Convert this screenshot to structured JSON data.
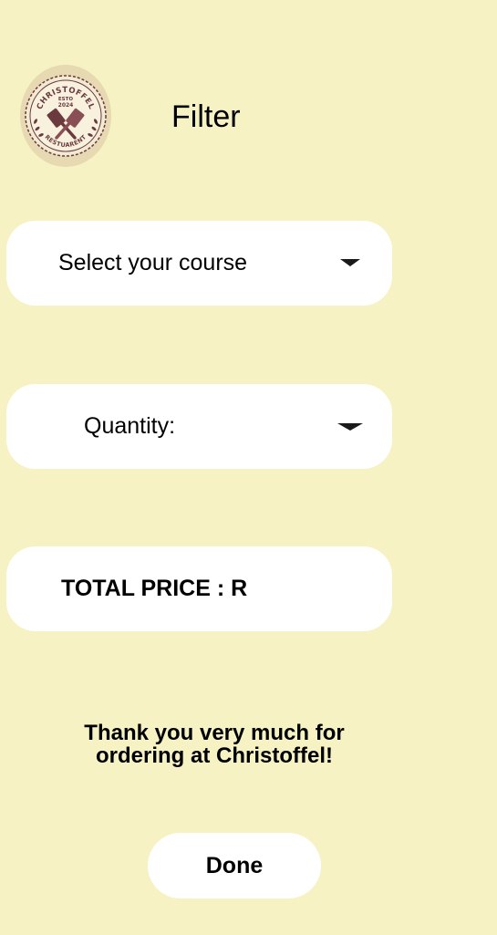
{
  "header": {
    "title": "Filter",
    "logo": {
      "icon": "restaurant-logo-icon",
      "top_text": "CHRISTOFFEL",
      "bottom_text": "RESTUARENT",
      "center_text_1": "ESTO",
      "center_text_2": "2024"
    }
  },
  "course_select": {
    "label": "Select your course",
    "icon": "chevron-down-icon"
  },
  "quantity_select": {
    "label": "Quantity:",
    "icon": "chevron-down-icon"
  },
  "total_price": {
    "label": "TOTAL PRICE :  R"
  },
  "thank_you": {
    "line1": "Thank you very much for",
    "line2": "ordering at Christoffel!"
  },
  "done_button": {
    "label": "Done"
  },
  "colors": {
    "background": "#f7f2c4",
    "surface": "#ffffff",
    "logo_ring": "#e7d9b1",
    "logo_primary": "#6b3a3f"
  }
}
